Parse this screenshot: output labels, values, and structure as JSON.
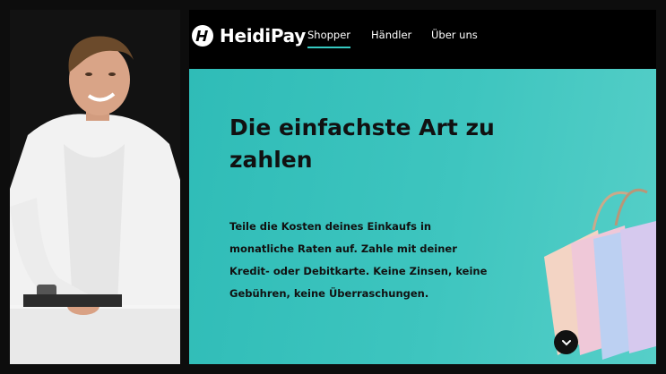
{
  "brand": {
    "name": "HeidiPay"
  },
  "nav": {
    "items": [
      {
        "label": "Shopper"
      },
      {
        "label": "Händler"
      },
      {
        "label": "Über uns"
      }
    ],
    "accent_color": "#35c9c1"
  },
  "hero": {
    "title": "Die einfachste Art zu zahlen",
    "text": "Teile die Kosten deines Einkaufs in monatliche Raten auf. Zahle mit deiner Kredit- oder Debitkarte. Keine Zinsen, keine Gebühren, keine Überraschungen.",
    "background_color": "#3ec5bf"
  },
  "icons": {
    "logo": "heidipay-logo-icon",
    "scroll": "chevron-down-icon"
  }
}
